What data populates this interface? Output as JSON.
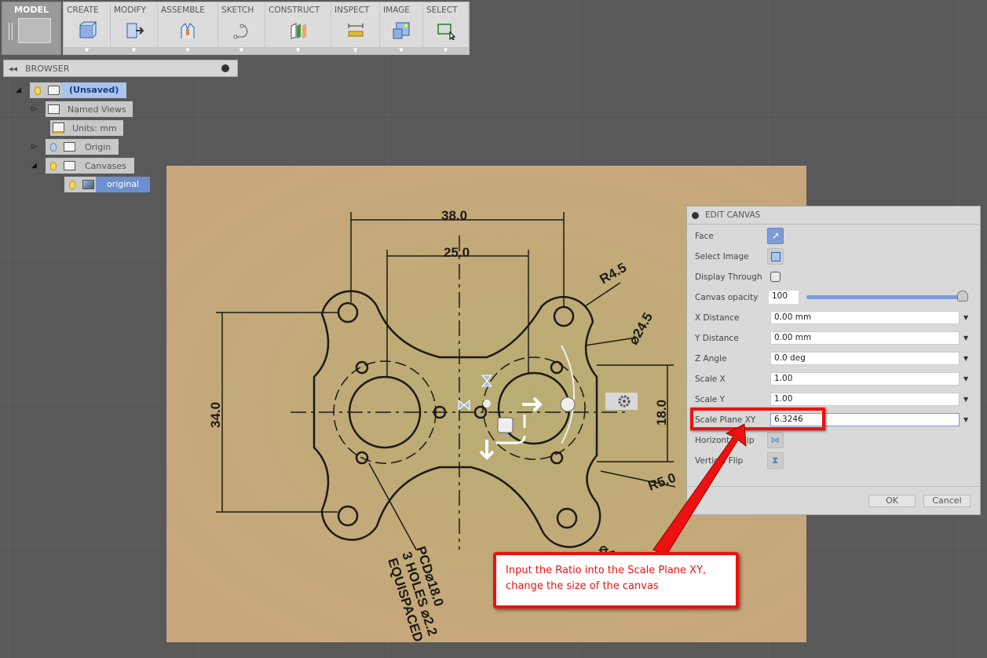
{
  "toolbar": {
    "model_label": "MODEL",
    "tools": [
      {
        "label": "CREATE",
        "icon": "box-icon"
      },
      {
        "label": "MODIFY",
        "icon": "press-pull-icon"
      },
      {
        "label": "ASSEMBLE",
        "icon": "joint-icon"
      },
      {
        "label": "SKETCH",
        "icon": "sketch-curve-icon"
      },
      {
        "label": "CONSTRUCT",
        "icon": "plane-icon"
      },
      {
        "label": "INSPECT",
        "icon": "measure-icon"
      },
      {
        "label": "IMAGE",
        "icon": "image-icon"
      },
      {
        "label": "SELECT",
        "icon": "select-window-icon"
      }
    ]
  },
  "browser": {
    "title": "BROWSER",
    "items": [
      {
        "label": "(Unsaved)"
      },
      {
        "label": "Named Views"
      },
      {
        "label": "Units: mm"
      },
      {
        "label": "Origin"
      },
      {
        "label": "Canvases"
      },
      {
        "label": "original"
      }
    ]
  },
  "drawing": {
    "dim_38": "38.0",
    "dim_25": "25.0",
    "dim_r45": "R4.5",
    "dim_d245": "⌀24.5",
    "dim_34": "34.0",
    "dim_18": "18.0",
    "dim_r5": "R5.0",
    "note_1": "PCD⌀18.0",
    "note_2": "3 HOLES ⌀2.2",
    "note_3": "EQUISPACED",
    "dim_partial": "⌀4"
  },
  "dialog": {
    "title": "EDIT CANVAS",
    "face_label": "Face",
    "select_image_label": "Select Image",
    "display_through_label": "Display Through",
    "display_through_checked": false,
    "opacity_label": "Canvas opacity",
    "opacity_value": "100",
    "opacity_fraction": 1.0,
    "x_distance_label": "X Distance",
    "x_distance_value": "0.00 mm",
    "y_distance_label": "Y Distance",
    "y_distance_value": "0.00 mm",
    "z_angle_label": "Z Angle",
    "z_angle_value": "0.0 deg",
    "scale_x_label": "Scale X",
    "scale_x_value": "1.00",
    "scale_y_label": "Scale Y",
    "scale_y_value": "1.00",
    "scale_plane_label": "Scale Plane XY",
    "scale_plane_value": "6.3246",
    "hflip_label": "Horizontal Flip",
    "vflip_label": "Vertical Flip",
    "ok_label": "OK",
    "cancel_label": "Cancel"
  },
  "callout": {
    "line1": "Input the Ratio into the Scale Plane XY,",
    "line2": "change the size of the canvas",
    "color": "#ee1111"
  }
}
